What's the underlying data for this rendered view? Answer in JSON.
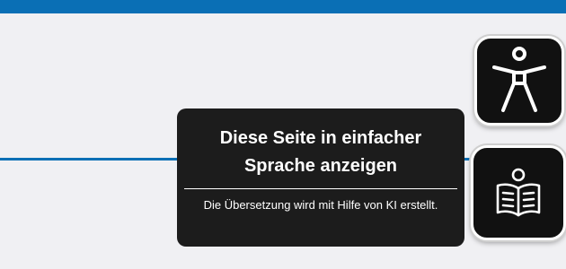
{
  "top_bar": {
    "color": "#0a6fb5"
  },
  "tooltip": {
    "title": "Diese Seite in einfacher Sprache anzeigen",
    "description": "Die Übersetzung wird mit Hilfe von KI erstellt."
  },
  "buttons": {
    "accessibility": {
      "icon": "accessibility-person-icon"
    },
    "easy_language": {
      "icon": "reading-person-icon"
    }
  },
  "colors": {
    "accent": "#0a6fb5",
    "tooltip_bg": "#1c1c1c",
    "button_bg": "#111111"
  }
}
